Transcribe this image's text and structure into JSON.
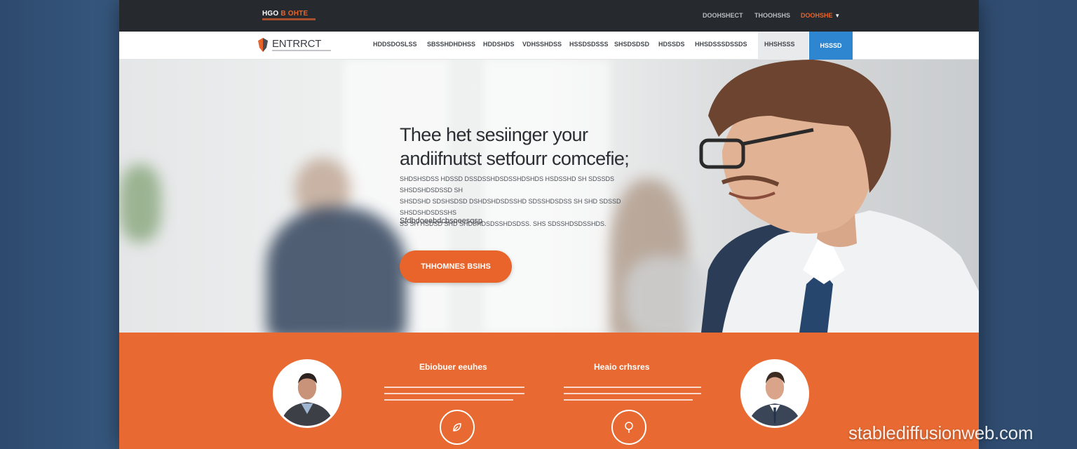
{
  "topbar": {
    "brand_main": "HGO ",
    "brand_accent": "B OHTE",
    "links": [
      "DOOHSHECT",
      "THOOHSHS"
    ],
    "highlight_link": "DOOHSHE"
  },
  "navbar": {
    "logo_text": "ENTRRCT",
    "items": [
      "HDDSDOSLSS",
      "SBSSHDHDHSS",
      "HDDSHDS",
      "VDHSSHDSS",
      "HSSDSDSSS",
      "SHSDSDSD",
      "HDSSDS",
      "HHSDSSSDSSDS",
      "HHSHSSS"
    ],
    "cta_label": "HSSSD"
  },
  "hero": {
    "title_line1": "Thee het sesiinger your",
    "title_line2": "andiifnutst setfourr comcefie;",
    "subtitle_lines": [
      "SHDSHSDSS HDSSD DSSDSSHDSDSSHDSHDS HSDSSHD SH SDSSDS SHSDSHDSDSSD SH",
      "SHSDSHD SDSHSDSD DSHDSHDSDSSHD SDSSHDSDSS SH SHD SDSSD SHSDSHDSDSSHS",
      "SS  SH  HSDSD  SHD  SHDSHDSDSSHDSDSS.  SHS SDSSHDSDSSHDS."
    ],
    "link_text": "Sfdbdoeebdcbsoeesqsp",
    "button_label": "THHOMNES BSIHS"
  },
  "features": {
    "left_title": "Ebiobuer eeuhes",
    "right_title": "Heaio crhsres"
  },
  "watermark": "stablediffusionweb.com"
}
